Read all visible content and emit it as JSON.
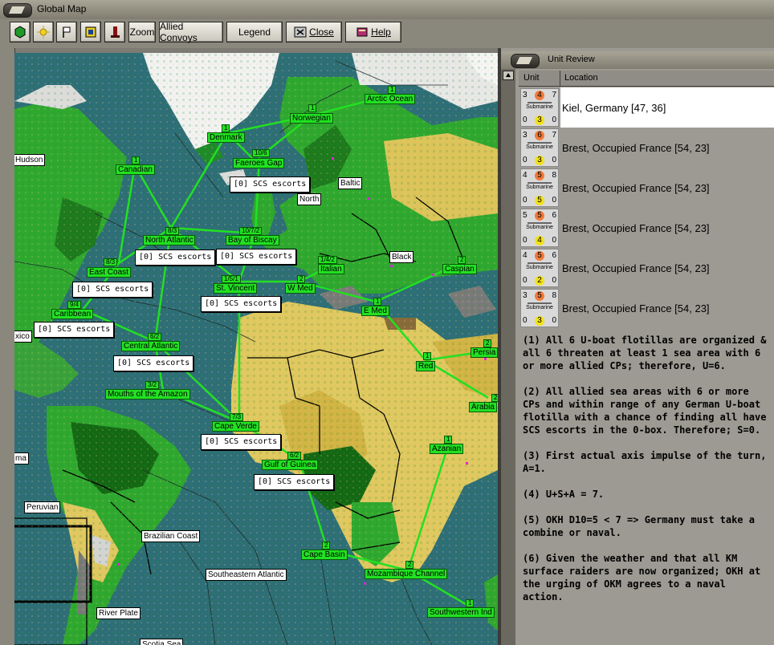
{
  "window": {
    "title": "Global Map"
  },
  "toolbar": {
    "zoom": "Zoom",
    "allied_convoys": "Allied Convoys",
    "legend": "Legend",
    "close": "Close",
    "help": "Help",
    "icons": [
      "hexagon-icon",
      "sun-icon",
      "flag-icon",
      "target-icon",
      "tower-icon"
    ]
  },
  "map": {
    "colors": {
      "ocean": "#2e6e78",
      "land_green": "#2fa82f",
      "desert": "#e0c860",
      "label_bg": "#22e022"
    },
    "sea_areas": [
      {
        "name": "Arctic Ocean",
        "count": "1"
      },
      {
        "name": "Norwegian",
        "count": "1"
      },
      {
        "name": "Denmark",
        "count": "1"
      },
      {
        "name": "Faeroes Gap",
        "count": "10/6"
      },
      {
        "name": "Canadian",
        "count": "1"
      },
      {
        "name": "North Atlantic",
        "count": "8/3"
      },
      {
        "name": "Bay of Biscay",
        "count": "10/7/2"
      },
      {
        "name": "East Coast",
        "count": "8/3"
      },
      {
        "name": "St. Vincent",
        "count": "1/5/1"
      },
      {
        "name": "W Med",
        "count": "2"
      },
      {
        "name": "Italian",
        "count": "1/4/2"
      },
      {
        "name": "E Med",
        "count": "1"
      },
      {
        "name": "Caspian",
        "count": "2"
      },
      {
        "name": "Caribbean",
        "count": "9/4"
      },
      {
        "name": "Central Atlantic",
        "count": "6/2"
      },
      {
        "name": "Mouths of the Amazon",
        "count": "3/2"
      },
      {
        "name": "Cape Verde",
        "count": "7/3"
      },
      {
        "name": "Gulf of Guinea",
        "count": "6/2"
      },
      {
        "name": "Red",
        "count": "1"
      },
      {
        "name": "Persia",
        "count": "2"
      },
      {
        "name": "Arabia",
        "count": "2"
      },
      {
        "name": "Azanian",
        "count": "1"
      },
      {
        "name": "Cape Basin",
        "count": "2"
      },
      {
        "name": "Mozambique Channel",
        "count": "2"
      },
      {
        "name": "Southwestern Ind",
        "count": "1"
      }
    ],
    "place_labels": [
      "Hudson",
      "Baltic",
      "North",
      "Black",
      "xico",
      "ma",
      "Peruvian",
      "Brazilian Coast",
      "Southeastern Atlantic",
      "River Plate",
      "Scotia Sea"
    ],
    "scs_escorts": [
      "[0] SCS escorts",
      "[0] SCS escorts",
      "[0] SCS escorts",
      "[0] SCS escorts",
      "[0] SCS escorts",
      "[0] SCS escorts",
      "[0] SCS escorts",
      "[0] SCS escorts",
      "[0] SCS escorts"
    ]
  },
  "unit_review": {
    "title": "Unit Review",
    "col_unit": "Unit",
    "col_location": "Location",
    "units": [
      {
        "tl": "3",
        "tm": "4",
        "tr": "7",
        "type": "Submarine",
        "bl": "0",
        "bm": "3",
        "br": "0",
        "location": "Kiel, Germany [47, 36]",
        "selected": true
      },
      {
        "tl": "3",
        "tm": "6",
        "tr": "7",
        "type": "Submarine",
        "bl": "0",
        "bm": "3",
        "br": "0",
        "location": "Brest, Occupied France [54, 23]",
        "selected": false
      },
      {
        "tl": "4",
        "tm": "5",
        "tr": "8",
        "type": "Submarine",
        "bl": "0",
        "bm": "5",
        "br": "0",
        "location": "Brest, Occupied France [54, 23]",
        "selected": false
      },
      {
        "tl": "5",
        "tm": "5",
        "tr": "6",
        "type": "Submarine",
        "bl": "0",
        "bm": "4",
        "br": "0",
        "location": "Brest, Occupied France [54, 23]",
        "selected": false
      },
      {
        "tl": "4",
        "tm": "5",
        "tr": "6",
        "type": "Submarine",
        "bl": "0",
        "bm": "2",
        "br": "0",
        "location": "Brest, Occupied France [54, 23]",
        "selected": false
      },
      {
        "tl": "3",
        "tm": "5",
        "tr": "8",
        "type": "Submarine",
        "bl": "0",
        "bm": "3",
        "br": "0",
        "location": "Brest, Occupied France [54, 23]",
        "selected": false
      }
    ]
  },
  "notes": [
    "(1) All 6 U-boat flotillas are organized & all 6 threaten at least 1 sea area with 6 or more allied CPs; therefore, U=6.",
    "(2) All allied sea areas with 6 or more CPs and within range of any German U-boat flotilla with a chance of finding all have SCS escorts in the 0-box.  Therefore; S=0.",
    "(3) First actual axis impulse of the turn, A=1.",
    "(4) U+S+A = 7.",
    "(5) OKH D10=5 < 7 => Germany must take a combine or naval.",
    "(6) Given the weather and that all KM surface raiders are now organized; OKH at the urging of OKM agrees to a naval action."
  ]
}
